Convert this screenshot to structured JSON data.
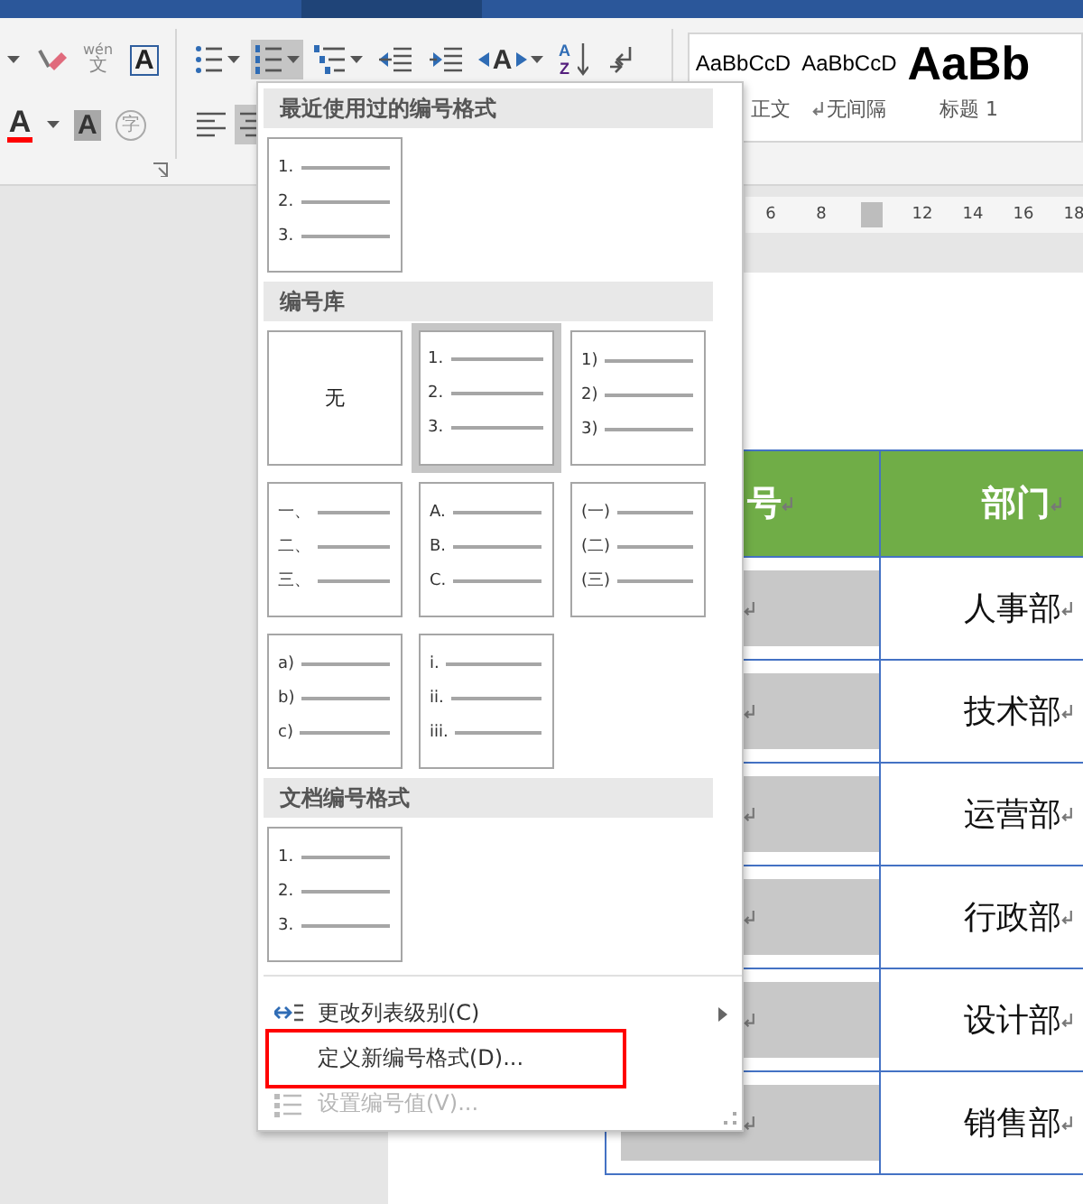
{
  "ribbon": {
    "font_row1": [
      {
        "kind": "caret"
      },
      {
        "kind": "eraser"
      },
      {
        "kind": "phonetic",
        "ruby": "wén",
        "base": "文"
      },
      {
        "kind": "boxed",
        "glyph": "A"
      }
    ],
    "font_row2": [
      {
        "kind": "font-color",
        "glyph": "A",
        "color": "#ff0000"
      },
      {
        "kind": "caret"
      },
      {
        "kind": "shaded",
        "glyph": "A"
      },
      {
        "kind": "enclosed",
        "glyph": "字"
      }
    ],
    "paragraph_row1": [
      {
        "kind": "bullets",
        "selected": false
      },
      {
        "kind": "numbering",
        "selected": true
      },
      {
        "kind": "multilevel",
        "selected": false
      },
      {
        "kind": "decrease-indent",
        "selected": false
      },
      {
        "kind": "increase-indent",
        "selected": false
      },
      {
        "kind": "text-direction",
        "glyph": "A",
        "selected": false
      },
      {
        "kind": "sort",
        "glyph": "A",
        "glyph2": "Z",
        "selected": false
      },
      {
        "kind": "marks",
        "selected": false
      }
    ],
    "paragraph_row2": [
      {
        "kind": "align-left",
        "selected": false
      },
      {
        "kind": "align-center",
        "selected": true
      }
    ],
    "styles": [
      {
        "sample": "AaBbCcD",
        "label": "正文",
        "kind": "normal"
      },
      {
        "sample": "AaBbCcD",
        "label": "无间隔",
        "kind": "no-spacing"
      },
      {
        "sample": "AaBb",
        "label": "标题 1",
        "kind": "heading"
      }
    ]
  },
  "ruler": [
    {
      "kind": "number",
      "label": "6"
    },
    {
      "kind": "number",
      "label": "8"
    },
    {
      "kind": "marker"
    },
    {
      "kind": "number",
      "label": "12"
    },
    {
      "kind": "number",
      "label": "14"
    },
    {
      "kind": "number",
      "label": "16"
    },
    {
      "kind": "number",
      "label": "18"
    }
  ],
  "table": {
    "columns": [
      {
        "label": "号"
      },
      {
        "label": "部门"
      }
    ],
    "rows": [
      {
        "dept": "人事部"
      },
      {
        "dept": "技术部"
      },
      {
        "dept": "运营部"
      },
      {
        "dept": "行政部"
      },
      {
        "dept": "设计部"
      },
      {
        "dept": "销售部"
      }
    ]
  },
  "numbering_menu": {
    "sections": [
      {
        "title": "最近使用过的编号格式",
        "tiles": [
          {
            "kind": "list",
            "markers": [
              "1.",
              "2.",
              "3."
            ],
            "selected": false
          }
        ]
      },
      {
        "title": "编号库",
        "tiles": [
          {
            "kind": "none",
            "label": "无",
            "selected": false
          },
          {
            "kind": "list",
            "markers": [
              "1.",
              "2.",
              "3."
            ],
            "selected": true
          },
          {
            "kind": "list",
            "markers": [
              "1)",
              "2)",
              "3)"
            ],
            "selected": false
          },
          {
            "kind": "list",
            "markers": [
              "一、",
              "二、",
              "三、"
            ],
            "selected": false
          },
          {
            "kind": "list",
            "markers": [
              "A.",
              "B.",
              "C."
            ],
            "selected": false
          },
          {
            "kind": "list",
            "markers": [
              "(一)",
              "(二)",
              "(三)"
            ],
            "selected": false
          },
          {
            "kind": "list",
            "markers": [
              "a)",
              "b)",
              "c)"
            ],
            "selected": false
          },
          {
            "kind": "list",
            "markers": [
              "i.",
              "ii.",
              "iii."
            ],
            "selected": false
          }
        ]
      },
      {
        "title": "文档编号格式",
        "tiles": [
          {
            "kind": "list",
            "markers": [
              "1.",
              "2.",
              "3."
            ],
            "selected": false
          }
        ]
      }
    ],
    "commands": [
      {
        "label": "更改列表级别(C)",
        "submenu": true,
        "disabled": false,
        "highlighted": false
      },
      {
        "label": "定义新编号格式(D)...",
        "submenu": false,
        "disabled": false,
        "highlighted": true
      },
      {
        "label": "设置编号值(V)...",
        "submenu": false,
        "disabled": true,
        "highlighted": false
      }
    ]
  }
}
